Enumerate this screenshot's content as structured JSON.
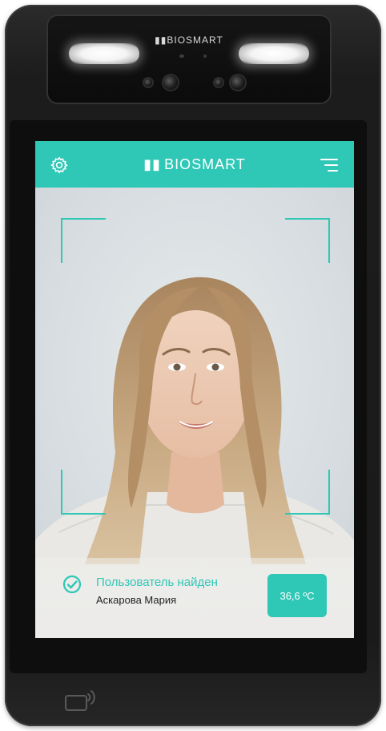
{
  "device": {
    "brand_label": "BIOSMART"
  },
  "app": {
    "logo_text": "BIOSMART",
    "colors": {
      "accent": "#2fc7b6",
      "bezel": "#1c1c1c"
    },
    "icons": {
      "settings": "gear-icon",
      "menu": "menu-icon",
      "status": "check-circle-icon",
      "nfc": "nfc-reader-icon"
    }
  },
  "recognition": {
    "status_text": "Пользователь найден",
    "user_name": "Аскарова Мария",
    "temperature": "36,6 ºC"
  }
}
